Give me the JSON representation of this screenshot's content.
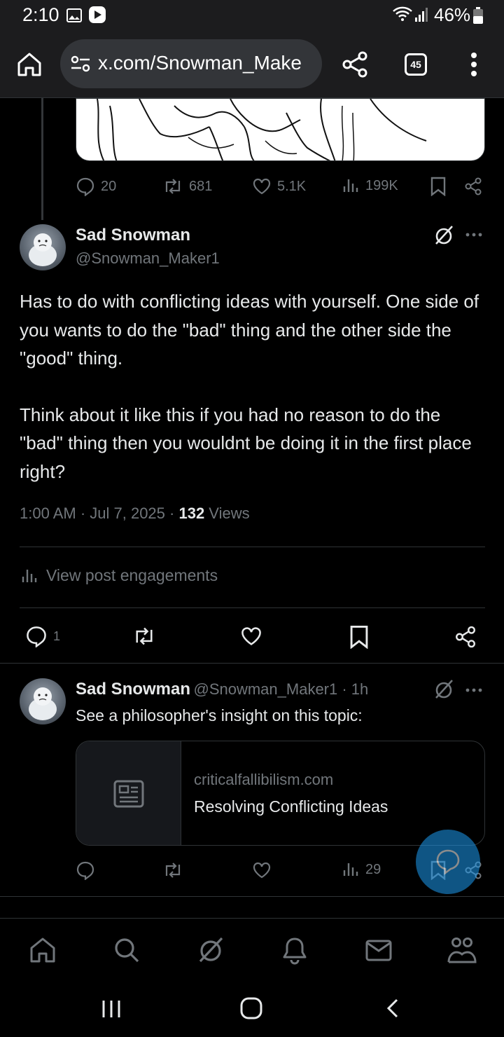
{
  "status_bar": {
    "time": "2:10",
    "battery": "46%"
  },
  "browser": {
    "url": "x.com/Snowman_Make",
    "tab_count": "45"
  },
  "prev_post": {
    "replies": "20",
    "reposts": "681",
    "likes": "5.1K",
    "views": "199K"
  },
  "post": {
    "author": "Sad Snowman",
    "handle": "@Snowman_Maker1",
    "paragraph1": "Has to do with conflicting ideas with yourself. One side of you wants to do the \"bad\" thing and the other side the \"good\" thing.",
    "paragraph2": "Think about it like this if you had no reason to do the \"bad\" thing then you wouldnt be doing it in the first place right?",
    "timestamp": "1:00 AM · Jul 7, 2025 · ",
    "view_count": "132",
    "views_label": " Views",
    "engagements_link": "View post engagements",
    "reply_count": "1"
  },
  "reply": {
    "author": "Sad Snowman",
    "handle_time": "@Snowman_Maker1 · 1h",
    "text": "See a philosopher's insight on this topic:",
    "card_domain": "criticalfallibilism.com",
    "card_title": "Resolving Conflicting Ideas",
    "views": "29"
  },
  "colors": {
    "accent": "#1d9bf0",
    "muted": "#71767b",
    "text": "#e7e9ea",
    "border": "#2f3336"
  }
}
